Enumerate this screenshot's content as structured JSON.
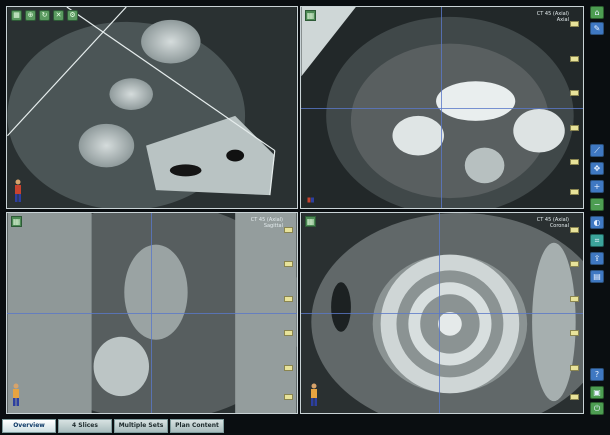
{
  "viewports": {
    "top_left": {
      "view": "3D oblique"
    },
    "top_right": {
      "label": "CT 45 (Axial)",
      "sublabel": "Axial"
    },
    "bottom_left": {
      "label": "CT 45 (Axial)",
      "sublabel": "Sagittal"
    },
    "bottom_right": {
      "label": "CT 45 (Axial)",
      "sublabel": "Coronal"
    }
  },
  "tabs": [
    {
      "label": "Overview",
      "active": true
    },
    {
      "label": "4 Slices",
      "active": false
    },
    {
      "label": "Multiple Sets",
      "active": false
    },
    {
      "label": "Plan Content",
      "active": false
    }
  ],
  "icons": {
    "toolbar": [
      "layout-icon",
      "zoom-icon",
      "rotate-icon",
      "reset-icon",
      "settings-icon"
    ],
    "sidebar": [
      "home-icon",
      "edit-icon",
      "measure-icon",
      "pan-icon",
      "zoom-in-icon",
      "zoom-out-icon",
      "window-level-icon",
      "crop-icon",
      "export-icon",
      "print-icon",
      "help-icon",
      "power-icon"
    ]
  },
  "colors": {
    "accent": "#3f78c2",
    "tab_active_text": "#0e3a68",
    "ruler_tick": "#e8e39a"
  }
}
